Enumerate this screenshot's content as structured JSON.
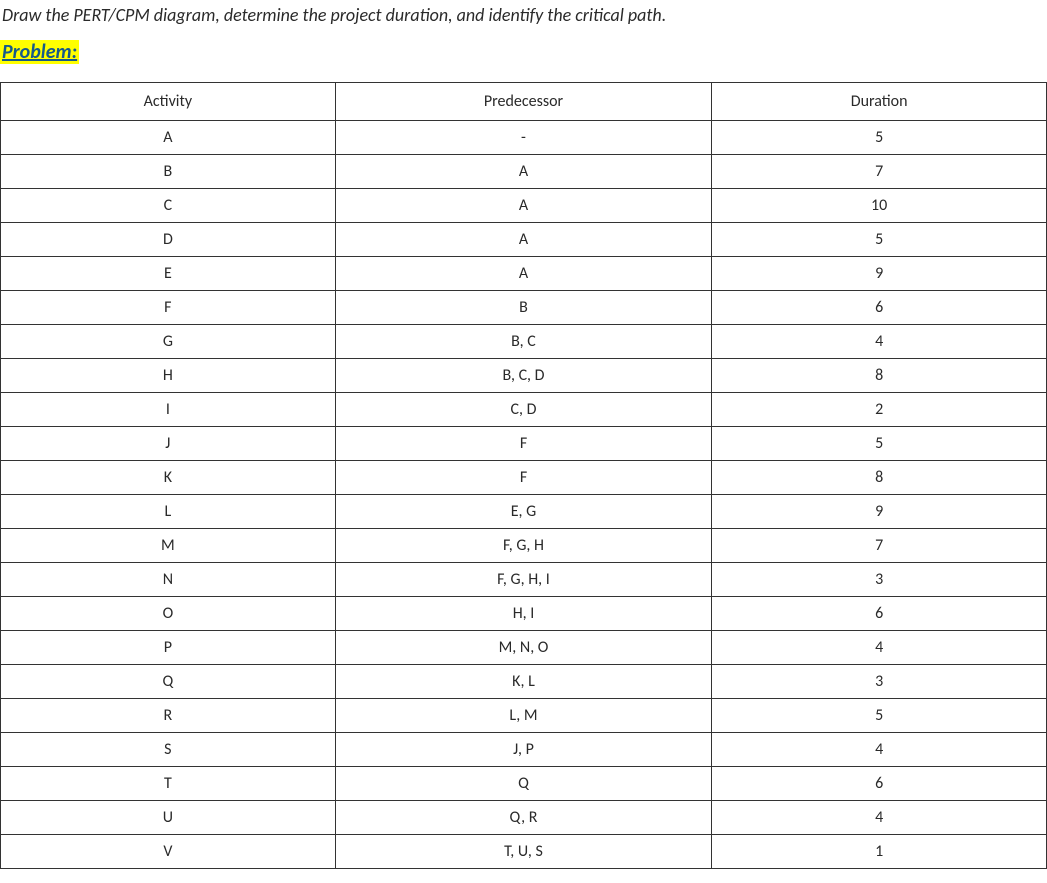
{
  "instruction": "Draw the PERT/CPM diagram, determine the project duration, and identify the critical path.",
  "problem_label": "Problem:",
  "table": {
    "headers": {
      "activity": "Activity",
      "predecessor": "Predecessor",
      "duration": "Duration"
    },
    "rows": [
      {
        "activity": "A",
        "predecessor": "-",
        "duration": "5"
      },
      {
        "activity": "B",
        "predecessor": "A",
        "duration": "7"
      },
      {
        "activity": "C",
        "predecessor": "A",
        "duration": "10"
      },
      {
        "activity": "D",
        "predecessor": "A",
        "duration": "5"
      },
      {
        "activity": "E",
        "predecessor": "A",
        "duration": "9"
      },
      {
        "activity": "F",
        "predecessor": "B",
        "duration": "6"
      },
      {
        "activity": "G",
        "predecessor": "B, C",
        "duration": "4"
      },
      {
        "activity": "H",
        "predecessor": "B, C, D",
        "duration": "8"
      },
      {
        "activity": "I",
        "predecessor": "C, D",
        "duration": "2"
      },
      {
        "activity": "J",
        "predecessor": "F",
        "duration": "5"
      },
      {
        "activity": "K",
        "predecessor": "F",
        "duration": "8"
      },
      {
        "activity": "L",
        "predecessor": "E, G",
        "duration": "9"
      },
      {
        "activity": "M",
        "predecessor": "F, G, H",
        "duration": "7"
      },
      {
        "activity": "N",
        "predecessor": "F, G, H, I",
        "duration": "3"
      },
      {
        "activity": "O",
        "predecessor": "H, I",
        "duration": "6"
      },
      {
        "activity": "P",
        "predecessor": "M, N, O",
        "duration": "4"
      },
      {
        "activity": "Q",
        "predecessor": "K, L",
        "duration": "3"
      },
      {
        "activity": "R",
        "predecessor": "L, M",
        "duration": "5"
      },
      {
        "activity": "S",
        "predecessor": "J, P",
        "duration": "4"
      },
      {
        "activity": "T",
        "predecessor": "Q",
        "duration": "6"
      },
      {
        "activity": "U",
        "predecessor": "Q, R",
        "duration": "4"
      },
      {
        "activity": "V",
        "predecessor": "T, U, S",
        "duration": "1"
      }
    ]
  }
}
